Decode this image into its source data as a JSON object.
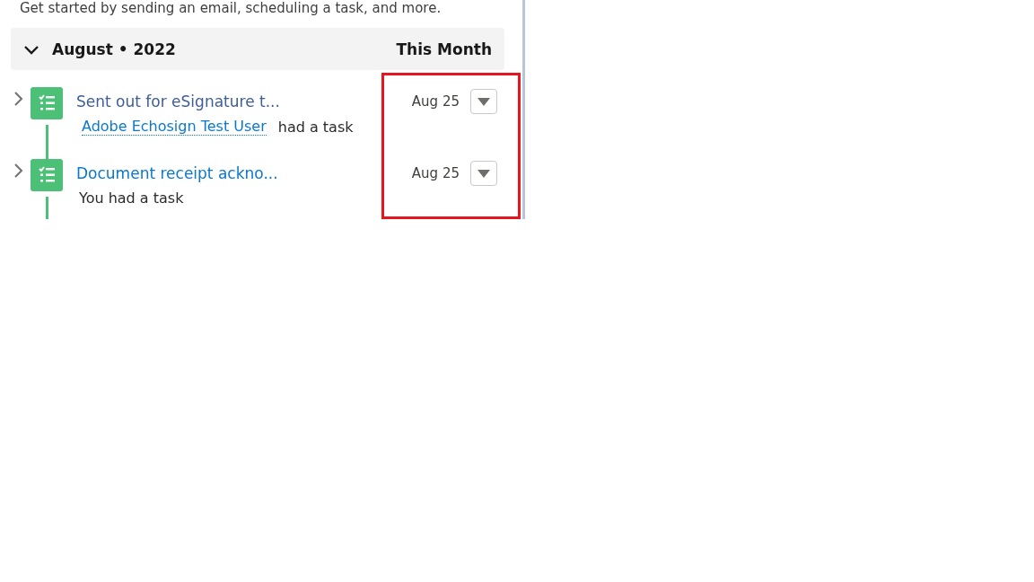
{
  "intro": "Get started by sending an email, scheduling a task, and more.",
  "group": {
    "title": "August • 2022",
    "period": "This Month",
    "expanded": true
  },
  "items": [
    {
      "title": "Sent out for eSignature t...",
      "visited": true,
      "actor_link": "Adobe Echosign Test User",
      "actor_text": "had a task",
      "date": "Aug 25",
      "expanded": false
    },
    {
      "title": "Document receipt ackno...",
      "visited": false,
      "actor_text": "You had a task",
      "date": "Aug 25",
      "expanded": false
    }
  ],
  "highlight": true
}
